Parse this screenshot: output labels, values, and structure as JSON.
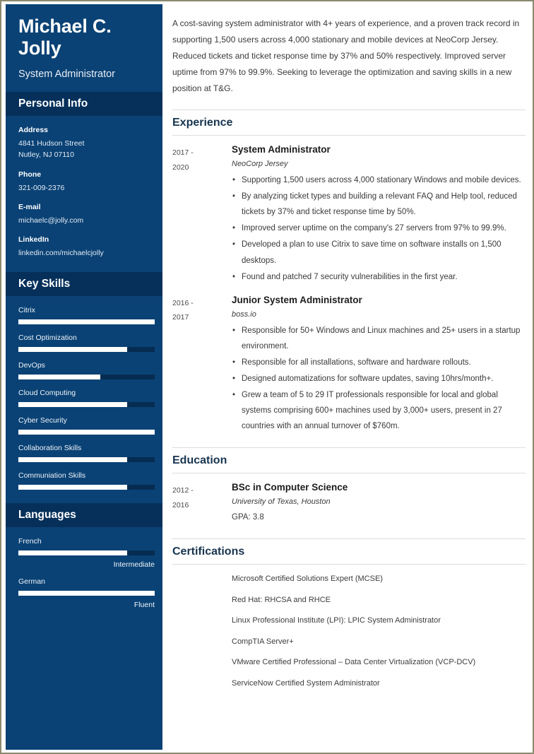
{
  "theme": {
    "sidebar_bg": "#0a4275",
    "sidebar_band_bg": "#06305a",
    "bar_fill": "#ffffff",
    "bar_track": "#062c52",
    "heading_color": "#18354f",
    "page_border": "#8b8a6e"
  },
  "sidebar": {
    "name": "Michael C. Jolly",
    "job_title": "System Administrator",
    "personal_info": {
      "heading": "Personal Info",
      "fields": [
        {
          "label": "Address",
          "value": "4841 Hudson Street\nNutley, NJ 07110"
        },
        {
          "label": "Phone",
          "value": "321-009-2376"
        },
        {
          "label": "E-mail",
          "value": "michaelc@jolly.com"
        },
        {
          "label": "LinkedIn",
          "value": "linkedin.com/michaelcjolly"
        }
      ]
    },
    "key_skills": {
      "heading": "Key Skills",
      "items": [
        {
          "name": "Citrix",
          "level": 100
        },
        {
          "name": "Cost Optimization",
          "level": 80
        },
        {
          "name": "DevOps",
          "level": 60
        },
        {
          "name": "Cloud Computing",
          "level": 80
        },
        {
          "name": "Cyber Security",
          "level": 100
        },
        {
          "name": "Collaboration Skills",
          "level": 80
        },
        {
          "name": "Communiation Skills",
          "level": 80
        }
      ]
    },
    "languages": {
      "heading": "Languages",
      "items": [
        {
          "name": "French",
          "level": 80,
          "proficiency": "Intermediate"
        },
        {
          "name": "German",
          "level": 100,
          "proficiency": "Fluent"
        }
      ]
    }
  },
  "main": {
    "summary": "A cost-saving system administrator with 4+ years of experience, and a proven track record in supporting 1,500 users across 4,000 stationary and mobile devices at NeoCorp Jersey. Reduced tickets and ticket response time by 37% and 50% respectively. Improved server uptime from 97% to 99.9%. Seeking to leverage the optimization and saving skills in a new position at T&G.",
    "experience": {
      "heading": "Experience",
      "entries": [
        {
          "dates": "2017 - 2020",
          "title": "System Administrator",
          "company": "NeoCorp Jersey",
          "bullets": [
            "Supporting 1,500 users across 4,000 stationary Windows and mobile devices.",
            "By analyzing ticket types and building a relevant FAQ and Help tool, reduced tickets by 37% and ticket response time by 50%.",
            "Improved server uptime on the company's 27 servers from 97% to 99.9%.",
            "Developed a plan to use Citrix to save time on software installs on 1,500 desktops.",
            "Found and patched 7 security vulnerabilities in the first year."
          ]
        },
        {
          "dates": "2016 - 2017",
          "title": "Junior System Administrator",
          "company": "boss.io",
          "bullets": [
            "Responsible for 50+ Windows and Linux machines and 25+ users in a startup environment.",
            "Responsible for all installations, software and hardware rollouts.",
            "Designed automatizations for software updates, saving 10hrs/month+.",
            "Grew a team of 5 to 29 IT professionals responsible for local and global systems comprising 600+ machines used by 3,000+ users, present in 27 countries with an annual turnover of $760m."
          ]
        }
      ]
    },
    "education": {
      "heading": "Education",
      "entries": [
        {
          "dates": "2012 - 2016",
          "title": "BSc in Computer Science",
          "school": "University of Texas, Houston",
          "gpa": "GPA: 3.8"
        }
      ]
    },
    "certifications": {
      "heading": "Certifications",
      "items": [
        "Microsoft Certified Solutions Expert (MCSE)",
        "Red Hat: RHCSA and RHCE",
        "Linux Professional Institute (LPI): LPIC System Administrator",
        "CompTIA Server+",
        "VMware Certified Professional – Data Center Virtualization (VCP-DCV)",
        "ServiceNow Certified System Administrator"
      ]
    }
  }
}
